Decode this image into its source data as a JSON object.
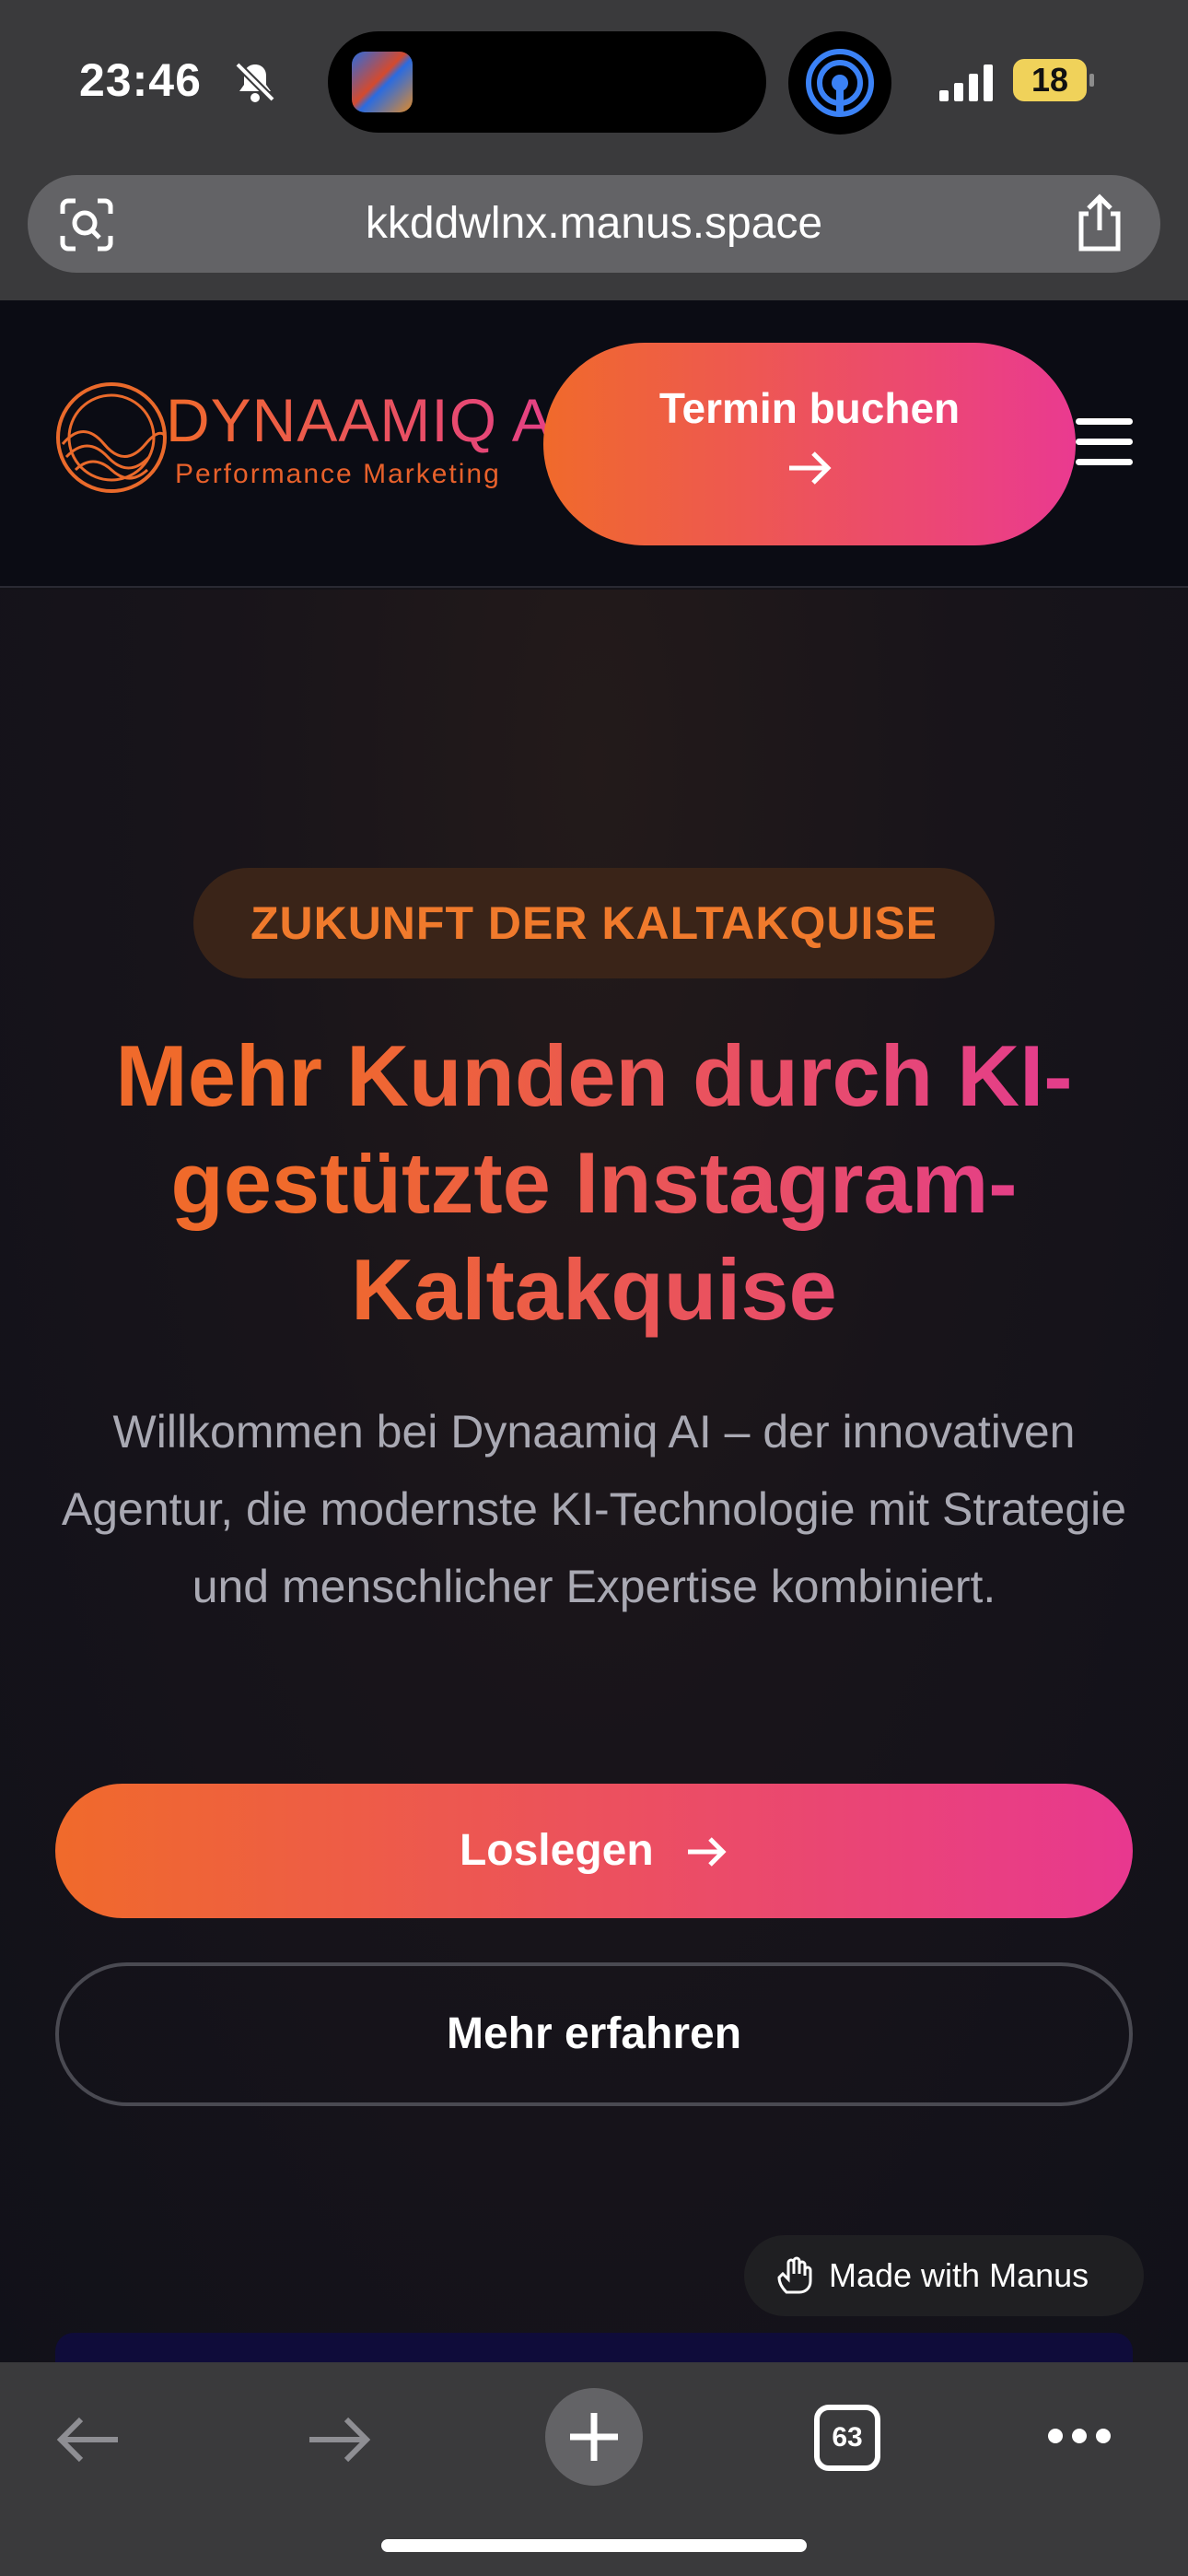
{
  "status_bar": {
    "time": "23:46",
    "battery": "18",
    "icons": [
      "bell-slash-icon",
      "airdrop-icon",
      "signal-icon",
      "battery-icon"
    ]
  },
  "browser": {
    "url": "kkddwlnx.manus.space",
    "tab_count": "63"
  },
  "header": {
    "logo_name": "DYNAAMIQ AI",
    "logo_tagline": "Performance Marketing",
    "cta_label": "Termin buchen"
  },
  "hero": {
    "eyebrow": "ZUKUNFT DER KALTAKQUISE",
    "headline": "Mehr Kunden durch KI-gestützte Instagram-Kaltakquise",
    "subtext": "Willkommen bei Dynaamiq AI – der innovativen Agentur, die modernste KI-Technologie mit Strategie und menschlicher Expertise kombiniert.",
    "primary_button": "Loslegen",
    "secondary_button": "Mehr erfahren"
  },
  "badge": {
    "label": "Made with Manus"
  },
  "colors": {
    "accent_orange": "#f06a2b",
    "accent_pink": "#e8388f",
    "background": "#141318"
  }
}
